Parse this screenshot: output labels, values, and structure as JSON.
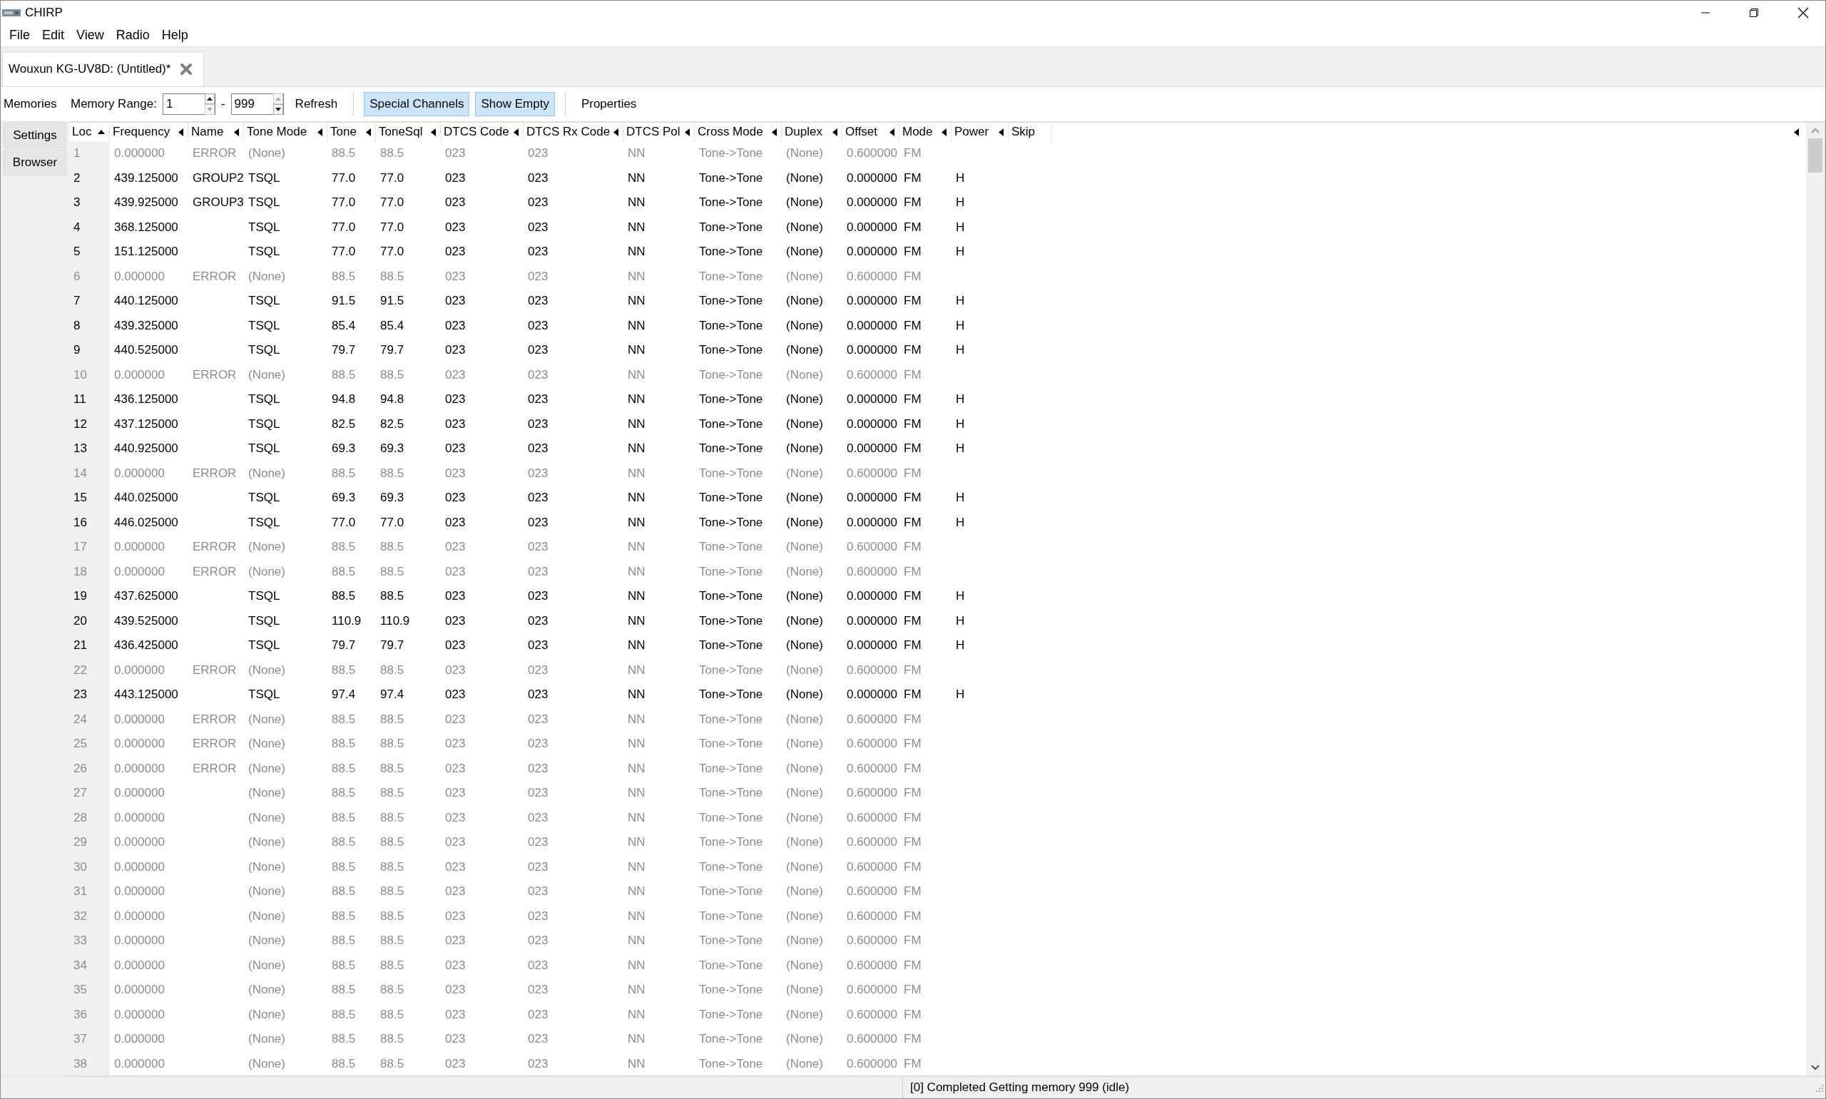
{
  "window": {
    "title": "CHIRP"
  },
  "menu": [
    "File",
    "Edit",
    "View",
    "Radio",
    "Help"
  ],
  "tabs": [
    {
      "label": "Wouxun KG-UV8D: (Untitled)*",
      "selected": true
    }
  ],
  "side_tabs": [
    {
      "label": "Memories",
      "selected": true
    },
    {
      "label": "Settings",
      "selected": false
    },
    {
      "label": "Browser",
      "selected": false
    }
  ],
  "toolbar": {
    "range_label": "Memory Range:",
    "range_from": "1",
    "range_separator": "-",
    "range_to": "999",
    "refresh": "Refresh",
    "toggles": [
      {
        "label": "Special Channels",
        "selected": true
      },
      {
        "label": "Show Empty",
        "selected": true
      }
    ],
    "properties": "Properties"
  },
  "table": {
    "columns": [
      {
        "label": "Loc",
        "arrow": true,
        "sorted": true
      },
      {
        "label": "Frequency",
        "arrow": true,
        "sorted": false
      },
      {
        "label": "Name",
        "arrow": true,
        "sorted": false
      },
      {
        "label": "Tone Mode",
        "arrow": true,
        "sorted": false
      },
      {
        "label": "Tone",
        "arrow": true,
        "sorted": false
      },
      {
        "label": "ToneSql",
        "arrow": true,
        "sorted": false
      },
      {
        "label": "DTCS Code",
        "arrow": true,
        "sorted": false
      },
      {
        "label": "DTCS Rx Code",
        "arrow": true,
        "sorted": false
      },
      {
        "label": "DTCS Pol",
        "arrow": true,
        "sorted": false
      },
      {
        "label": "Cross Mode",
        "arrow": true,
        "sorted": false
      },
      {
        "label": "Duplex",
        "arrow": true,
        "sorted": false
      },
      {
        "label": "Offset",
        "arrow": true,
        "sorted": false
      },
      {
        "label": "Mode",
        "arrow": true,
        "sorted": false
      },
      {
        "label": "Power",
        "arrow": true,
        "sorted": false
      },
      {
        "label": "Skip",
        "arrow": false,
        "sorted": false
      }
    ],
    "rows": [
      {
        "empty": true,
        "cells": [
          "1",
          "0.000000",
          "ERROR",
          "(None)",
          "88.5",
          "88.5",
          "023",
          "023",
          "NN",
          "Tone->Tone",
          "(None)",
          "0.600000",
          "FM",
          null
        ]
      },
      {
        "empty": false,
        "cells": [
          "2",
          "439.125000",
          "GROUP2",
          "TSQL",
          "77.0",
          "77.0",
          "023",
          "023",
          "NN",
          "Tone->Tone",
          "(None)",
          "0.000000",
          "FM",
          "H"
        ]
      },
      {
        "empty": false,
        "cells": [
          "3",
          "439.925000",
          "GROUP3",
          "TSQL",
          "77.0",
          "77.0",
          "023",
          "023",
          "NN",
          "Tone->Tone",
          "(None)",
          "0.000000",
          "FM",
          "H"
        ]
      },
      {
        "empty": false,
        "cells": [
          "4",
          "368.125000",
          null,
          "TSQL",
          "77.0",
          "77.0",
          "023",
          "023",
          "NN",
          "Tone->Tone",
          "(None)",
          "0.000000",
          "FM",
          "H"
        ]
      },
      {
        "empty": false,
        "cells": [
          "5",
          "151.125000",
          null,
          "TSQL",
          "77.0",
          "77.0",
          "023",
          "023",
          "NN",
          "Tone->Tone",
          "(None)",
          "0.000000",
          "FM",
          "H"
        ]
      },
      {
        "empty": true,
        "cells": [
          "6",
          "0.000000",
          "ERROR",
          "(None)",
          "88.5",
          "88.5",
          "023",
          "023",
          "NN",
          "Tone->Tone",
          "(None)",
          "0.600000",
          "FM",
          null
        ]
      },
      {
        "empty": false,
        "cells": [
          "7",
          "440.125000",
          null,
          "TSQL",
          "91.5",
          "91.5",
          "023",
          "023",
          "NN",
          "Tone->Tone",
          "(None)",
          "0.000000",
          "FM",
          "H"
        ]
      },
      {
        "empty": false,
        "cells": [
          "8",
          "439.325000",
          null,
          "TSQL",
          "85.4",
          "85.4",
          "023",
          "023",
          "NN",
          "Tone->Tone",
          "(None)",
          "0.000000",
          "FM",
          "H"
        ]
      },
      {
        "empty": false,
        "cells": [
          "9",
          "440.525000",
          null,
          "TSQL",
          "79.7",
          "79.7",
          "023",
          "023",
          "NN",
          "Tone->Tone",
          "(None)",
          "0.000000",
          "FM",
          "H"
        ]
      },
      {
        "empty": true,
        "cells": [
          "10",
          "0.000000",
          "ERROR",
          "(None)",
          "88.5",
          "88.5",
          "023",
          "023",
          "NN",
          "Tone->Tone",
          "(None)",
          "0.600000",
          "FM",
          null
        ]
      },
      {
        "empty": false,
        "cells": [
          "11",
          "436.125000",
          null,
          "TSQL",
          "94.8",
          "94.8",
          "023",
          "023",
          "NN",
          "Tone->Tone",
          "(None)",
          "0.000000",
          "FM",
          "H"
        ]
      },
      {
        "empty": false,
        "cells": [
          "12",
          "437.125000",
          null,
          "TSQL",
          "82.5",
          "82.5",
          "023",
          "023",
          "NN",
          "Tone->Tone",
          "(None)",
          "0.000000",
          "FM",
          "H"
        ]
      },
      {
        "empty": false,
        "cells": [
          "13",
          "440.925000",
          null,
          "TSQL",
          "69.3",
          "69.3",
          "023",
          "023",
          "NN",
          "Tone->Tone",
          "(None)",
          "0.000000",
          "FM",
          "H"
        ]
      },
      {
        "empty": true,
        "cells": [
          "14",
          "0.000000",
          "ERROR",
          "(None)",
          "88.5",
          "88.5",
          "023",
          "023",
          "NN",
          "Tone->Tone",
          "(None)",
          "0.600000",
          "FM",
          null
        ]
      },
      {
        "empty": false,
        "cells": [
          "15",
          "440.025000",
          null,
          "TSQL",
          "69.3",
          "69.3",
          "023",
          "023",
          "NN",
          "Tone->Tone",
          "(None)",
          "0.000000",
          "FM",
          "H"
        ]
      },
      {
        "empty": false,
        "cells": [
          "16",
          "446.025000",
          null,
          "TSQL",
          "77.0",
          "77.0",
          "023",
          "023",
          "NN",
          "Tone->Tone",
          "(None)",
          "0.000000",
          "FM",
          "H"
        ]
      },
      {
        "empty": true,
        "cells": [
          "17",
          "0.000000",
          "ERROR",
          "(None)",
          "88.5",
          "88.5",
          "023",
          "023",
          "NN",
          "Tone->Tone",
          "(None)",
          "0.600000",
          "FM",
          null
        ]
      },
      {
        "empty": true,
        "cells": [
          "18",
          "0.000000",
          "ERROR",
          "(None)",
          "88.5",
          "88.5",
          "023",
          "023",
          "NN",
          "Tone->Tone",
          "(None)",
          "0.600000",
          "FM",
          null
        ]
      },
      {
        "empty": false,
        "cells": [
          "19",
          "437.625000",
          null,
          "TSQL",
          "88.5",
          "88.5",
          "023",
          "023",
          "NN",
          "Tone->Tone",
          "(None)",
          "0.000000",
          "FM",
          "H"
        ]
      },
      {
        "empty": false,
        "cells": [
          "20",
          "439.525000",
          null,
          "TSQL",
          "110.9",
          "110.9",
          "023",
          "023",
          "NN",
          "Tone->Tone",
          "(None)",
          "0.000000",
          "FM",
          "H"
        ]
      },
      {
        "empty": false,
        "cells": [
          "21",
          "436.425000",
          null,
          "TSQL",
          "79.7",
          "79.7",
          "023",
          "023",
          "NN",
          "Tone->Tone",
          "(None)",
          "0.000000",
          "FM",
          "H"
        ]
      },
      {
        "empty": true,
        "cells": [
          "22",
          "0.000000",
          "ERROR",
          "(None)",
          "88.5",
          "88.5",
          "023",
          "023",
          "NN",
          "Tone->Tone",
          "(None)",
          "0.600000",
          "FM",
          null
        ]
      },
      {
        "empty": false,
        "cells": [
          "23",
          "443.125000",
          null,
          "TSQL",
          "97.4",
          "97.4",
          "023",
          "023",
          "NN",
          "Tone->Tone",
          "(None)",
          "0.000000",
          "FM",
          "H"
        ]
      },
      {
        "empty": true,
        "cells": [
          "24",
          "0.000000",
          "ERROR",
          "(None)",
          "88.5",
          "88.5",
          "023",
          "023",
          "NN",
          "Tone->Tone",
          "(None)",
          "0.600000",
          "FM",
          null
        ]
      },
      {
        "empty": true,
        "cells": [
          "25",
          "0.000000",
          "ERROR",
          "(None)",
          "88.5",
          "88.5",
          "023",
          "023",
          "NN",
          "Tone->Tone",
          "(None)",
          "0.600000",
          "FM",
          null
        ]
      },
      {
        "empty": true,
        "cells": [
          "26",
          "0.000000",
          "ERROR",
          "(None)",
          "88.5",
          "88.5",
          "023",
          "023",
          "NN",
          "Tone->Tone",
          "(None)",
          "0.600000",
          "FM",
          null
        ]
      },
      {
        "empty": true,
        "cells": [
          "27",
          "0.000000",
          null,
          "(None)",
          "88.5",
          "88.5",
          "023",
          "023",
          "NN",
          "Tone->Tone",
          "(None)",
          "0.600000",
          "FM",
          null
        ]
      },
      {
        "empty": true,
        "cells": [
          "28",
          "0.000000",
          null,
          "(None)",
          "88.5",
          "88.5",
          "023",
          "023",
          "NN",
          "Tone->Tone",
          "(None)",
          "0.600000",
          "FM",
          null
        ]
      },
      {
        "empty": true,
        "cells": [
          "29",
          "0.000000",
          null,
          "(None)",
          "88.5",
          "88.5",
          "023",
          "023",
          "NN",
          "Tone->Tone",
          "(None)",
          "0.600000",
          "FM",
          null
        ]
      },
      {
        "empty": true,
        "cells": [
          "30",
          "0.000000",
          null,
          "(None)",
          "88.5",
          "88.5",
          "023",
          "023",
          "NN",
          "Tone->Tone",
          "(None)",
          "0.600000",
          "FM",
          null
        ]
      },
      {
        "empty": true,
        "cells": [
          "31",
          "0.000000",
          null,
          "(None)",
          "88.5",
          "88.5",
          "023",
          "023",
          "NN",
          "Tone->Tone",
          "(None)",
          "0.600000",
          "FM",
          null
        ]
      },
      {
        "empty": true,
        "cells": [
          "32",
          "0.000000",
          null,
          "(None)",
          "88.5",
          "88.5",
          "023",
          "023",
          "NN",
          "Tone->Tone",
          "(None)",
          "0.600000",
          "FM",
          null
        ]
      },
      {
        "empty": true,
        "cells": [
          "33",
          "0.000000",
          null,
          "(None)",
          "88.5",
          "88.5",
          "023",
          "023",
          "NN",
          "Tone->Tone",
          "(None)",
          "0.600000",
          "FM",
          null
        ]
      },
      {
        "empty": true,
        "cells": [
          "34",
          "0.000000",
          null,
          "(None)",
          "88.5",
          "88.5",
          "023",
          "023",
          "NN",
          "Tone->Tone",
          "(None)",
          "0.600000",
          "FM",
          null
        ]
      },
      {
        "empty": true,
        "cells": [
          "35",
          "0.000000",
          null,
          "(None)",
          "88.5",
          "88.5",
          "023",
          "023",
          "NN",
          "Tone->Tone",
          "(None)",
          "0.600000",
          "FM",
          null
        ]
      },
      {
        "empty": true,
        "cells": [
          "36",
          "0.000000",
          null,
          "(None)",
          "88.5",
          "88.5",
          "023",
          "023",
          "NN",
          "Tone->Tone",
          "(None)",
          "0.600000",
          "FM",
          null
        ]
      },
      {
        "empty": true,
        "cells": [
          "37",
          "0.000000",
          null,
          "(None)",
          "88.5",
          "88.5",
          "023",
          "023",
          "NN",
          "Tone->Tone",
          "(None)",
          "0.600000",
          "FM",
          null
        ]
      },
      {
        "empty": true,
        "cells": [
          "38",
          "0.000000",
          null,
          "(None)",
          "88.5",
          "88.5",
          "023",
          "023",
          "NN",
          "Tone->Tone",
          "(None)",
          "0.600000",
          "FM",
          null
        ]
      }
    ]
  },
  "status_bar": {
    "message": "[0] Completed Getting memory 999 (idle)"
  }
}
